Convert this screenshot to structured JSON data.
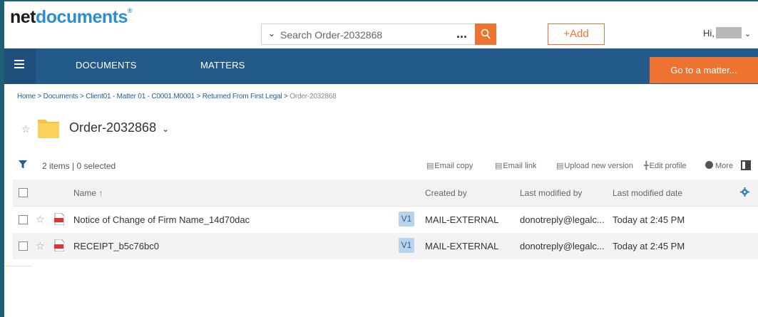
{
  "logo": {
    "net": "net",
    "documents": "documents",
    "mark": "®"
  },
  "search": {
    "placeholder": "Search Order-2032868",
    "more": "..."
  },
  "add_button": "+Add",
  "user": {
    "greeting": "Hi,"
  },
  "nav": {
    "documents": "DOCUMENTS",
    "matters": "MATTERS",
    "goto": "Go to a matter..."
  },
  "breadcrumb": {
    "path": "Home > Documents > Client01 - Matter 01 - C0001.M0001 > Returned From First Legal > ",
    "last": "Order-2032868"
  },
  "folder": {
    "title": "Order-2032868"
  },
  "toolbar": {
    "count": "2 items | 0 selected",
    "actions": {
      "email_copy": "Email copy",
      "email_link": "Email link",
      "upload_new_version": "Upload new version",
      "edit_profile": "Edit profile",
      "more": "More"
    }
  },
  "table": {
    "headers": {
      "name": "Name",
      "created_by": "Created by",
      "last_modified_by": "Last modified by",
      "last_modified_date": "Last modified date"
    },
    "rows": [
      {
        "name": "Notice of Change of Firm Name_14d70dac",
        "version": "V1",
        "created_by": "MAIL-EXTERNAL",
        "modified_by": "donotreply@legalc...",
        "modified_date": "Today at 2:45 PM"
      },
      {
        "name": "RECEIPT_b5c76bc0",
        "version": "V1",
        "created_by": "MAIL-EXTERNAL",
        "modified_by": "donotreply@legalc...",
        "modified_date": "Today at 2:45 PM"
      }
    ]
  },
  "colors": {
    "nav": "#225b8a",
    "accent": "#ee7330",
    "link": "#1f5f9a",
    "version_badge": "#b9d4ea"
  },
  "icons": [
    "star-icon",
    "folder-icon",
    "filter-icon",
    "pdf-icon",
    "gear-icon",
    "search-icon",
    "menu-icon",
    "panel-icon"
  ]
}
